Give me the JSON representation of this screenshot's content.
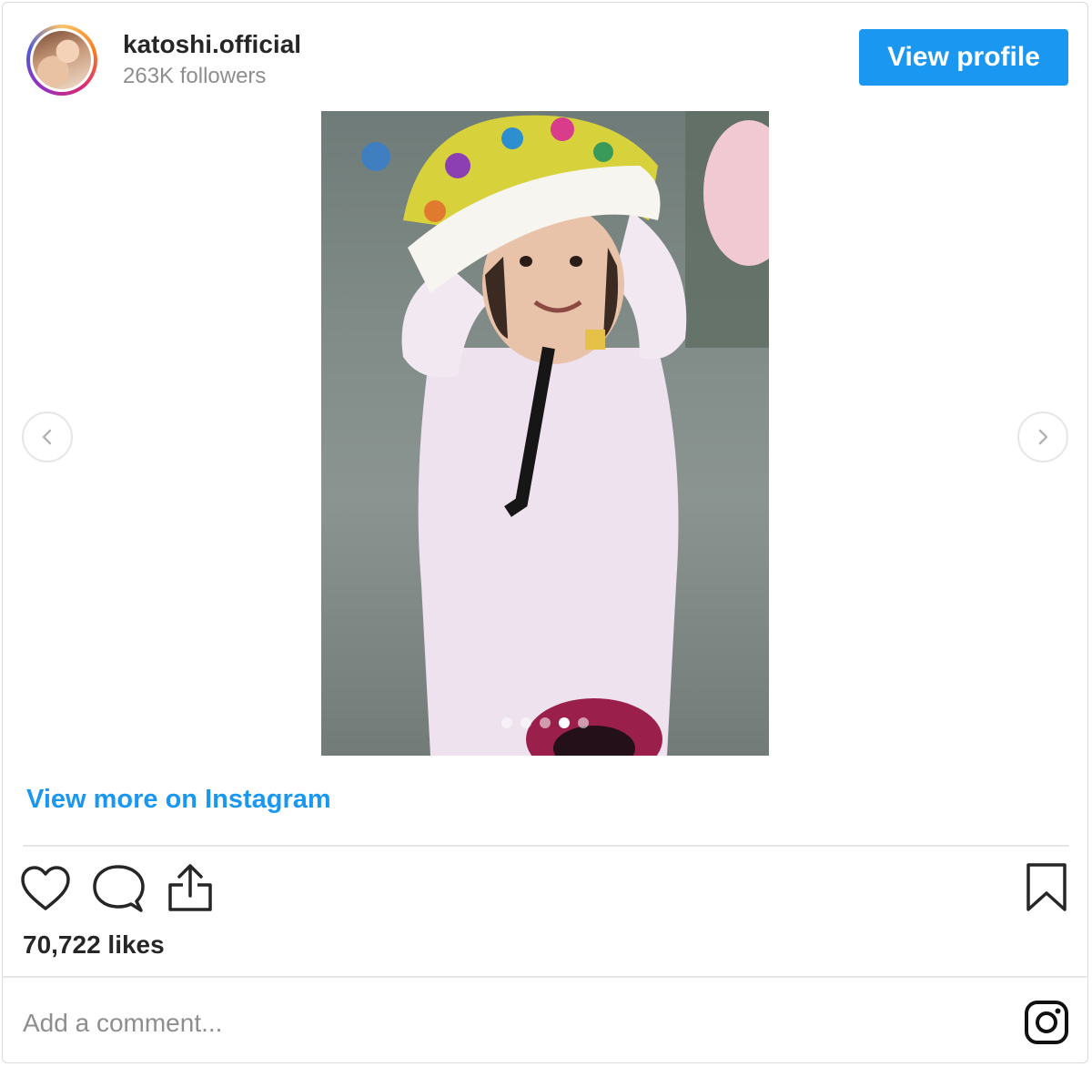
{
  "header": {
    "username": "katoshi.official",
    "followers": "263K followers",
    "view_profile_label": "View profile"
  },
  "carousel": {
    "slide_count": 5,
    "active_index": 3
  },
  "view_more_label": "View more on Instagram",
  "likes_text": "70,722 likes",
  "comment": {
    "placeholder": "Add a comment..."
  },
  "colors": {
    "accent": "#1a97f0",
    "text": "#262626",
    "muted": "#8e8e8e"
  },
  "icons": [
    "heart-icon",
    "comment-icon",
    "share-icon",
    "bookmark-icon",
    "instagram-logo-icon",
    "chevron-left-icon",
    "chevron-right-icon"
  ]
}
